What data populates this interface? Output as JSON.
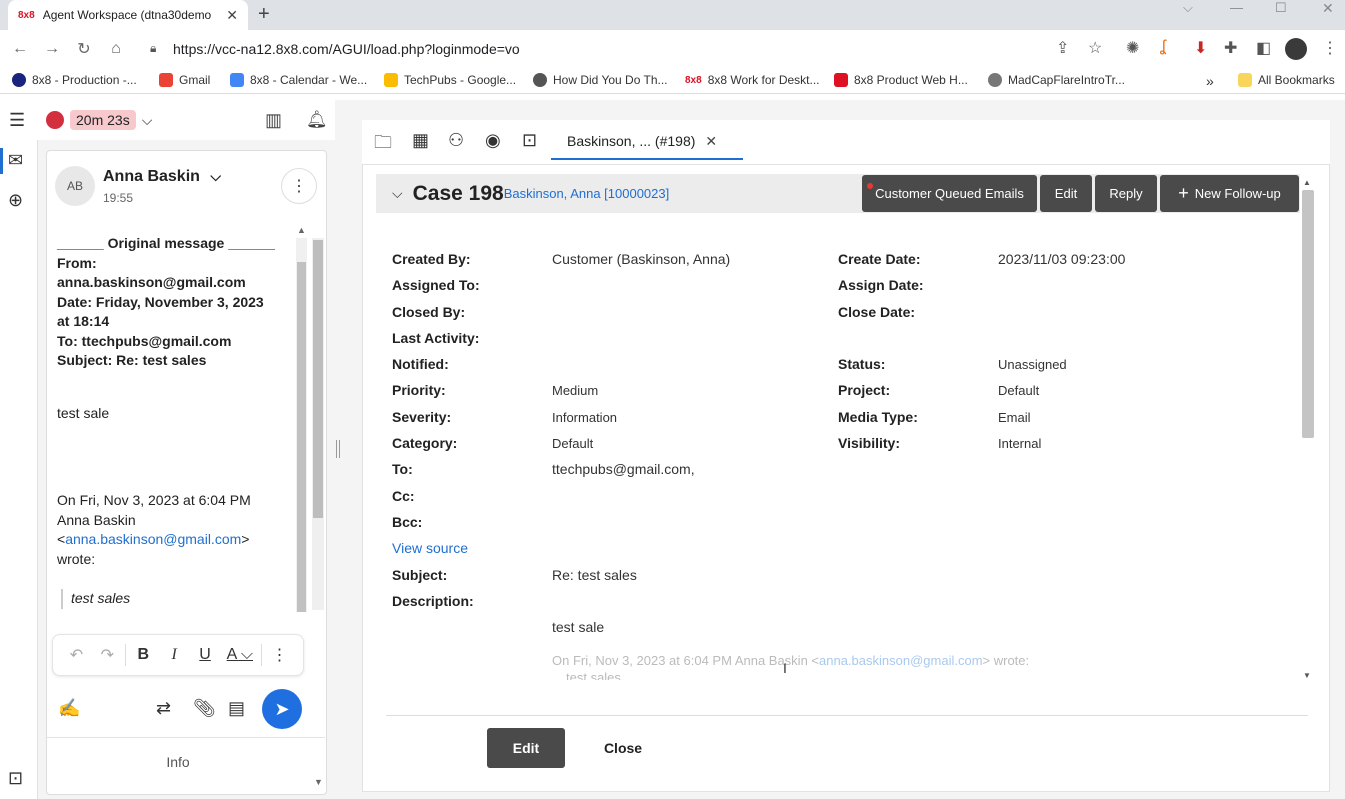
{
  "browser": {
    "tab_title": "Agent Workspace (dtna30demo",
    "tab_favicon": "8x8",
    "url": "https://vcc-na12.8x8.com/AGUI/load.php?loginmode=vo",
    "bookmarks": [
      "8x8 - Production -...",
      "Gmail",
      "8x8 - Calendar - We...",
      "TechPubs - Google...",
      "How Did You Do Th...",
      "8x8 Work for Deskt...",
      "8x8 Product Web H...",
      "MadCapFlareIntroTr..."
    ],
    "bookmarks_more": "»",
    "all_bookmarks": "All Bookmarks"
  },
  "topbar": {
    "timer": "20m 23s"
  },
  "email": {
    "avatar_initials": "AB",
    "sender_name": "Anna Baskin",
    "time": "19:55",
    "lines_bold": [
      "______ Original message ______",
      "From:",
      "anna.baskinson@gmail.com",
      "Date: Friday, November 3, 2023",
      "at 18:14",
      "To: ttechpubs@gmail.com",
      "Subject: Re: test sales"
    ],
    "body_text": "test sale",
    "reply_line1": "On Fri, Nov 3, 2023 at 6:04 PM",
    "reply_line2": "Anna Baskin",
    "reply_line3_pre": "<",
    "reply_email": "anna.baskinson@gmail.com",
    "reply_line3_post": ">",
    "reply_line4": "wrote:",
    "quoted": "test sales",
    "info_label": "Info"
  },
  "case": {
    "tab_label": "Baskinson, ...  (#198)",
    "title": "Case 198",
    "customer_link": "Baskinson, Anna [10000023]",
    "buttons": {
      "queued": "Customer Queued Emails",
      "edit": "Edit",
      "reply": "Reply",
      "follow_up": "New Follow-up"
    },
    "fields_left": [
      {
        "label": "Created By:",
        "value": "Customer (Baskinson, Anna)"
      },
      {
        "label": "Assigned To:",
        "value": ""
      },
      {
        "label": "Closed By:",
        "value": ""
      },
      {
        "label": "Last Activity:",
        "value": ""
      },
      {
        "label": "Notified:",
        "value": ""
      },
      {
        "label": "Priority:",
        "value": "Medium"
      },
      {
        "label": "Severity:",
        "value": "Information"
      },
      {
        "label": "Category:",
        "value": "Default"
      },
      {
        "label": "To:",
        "value": "ttechpubs@gmail.com,"
      },
      {
        "label": "Cc:",
        "value": ""
      },
      {
        "label": "Bcc:",
        "value": ""
      }
    ],
    "fields_right": [
      {
        "label": "Create Date:",
        "value": "2023/11/03 09:23:00"
      },
      {
        "label": "Assign Date:",
        "value": ""
      },
      {
        "label": "Close Date:",
        "value": ""
      },
      {
        "label": "Status:",
        "value": "Unassigned"
      },
      {
        "label": "Project:",
        "value": "Default"
      },
      {
        "label": "Media Type:",
        "value": "Email"
      },
      {
        "label": "Visibility:",
        "value": "Internal"
      }
    ],
    "view_source": "View source",
    "subject_label": "Subject:",
    "subject_value": "Re: test sales",
    "description_label": "Description:",
    "description_text": "test sale",
    "description_reply_pre": "On Fri, Nov 3, 2023 at 6:04 PM Anna Baskin <",
    "description_reply_email": "anna.baskinson@gmail.com",
    "description_reply_post": "> wrote:",
    "description_quote": "test sales",
    "footer_edit": "Edit",
    "footer_close": "Close"
  }
}
